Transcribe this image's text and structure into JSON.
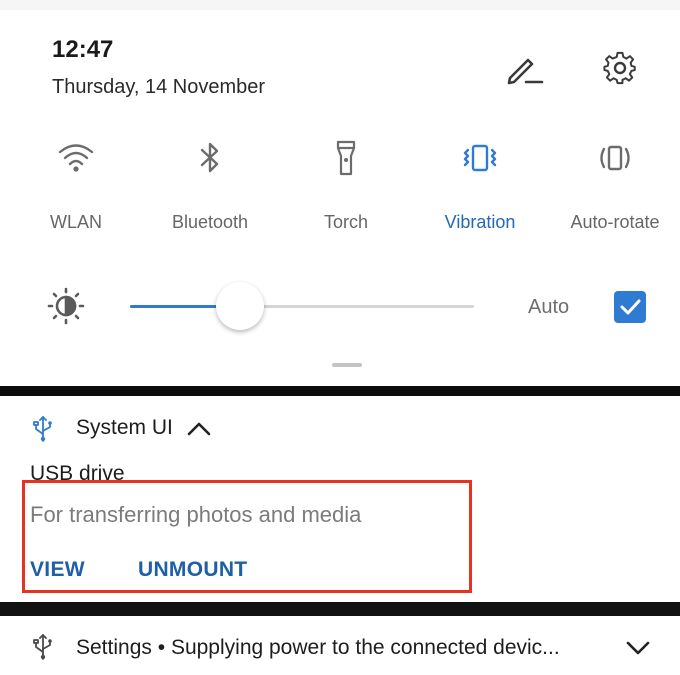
{
  "status": {
    "time": "12:47",
    "date": "Thursday, 14 November"
  },
  "header_icons": {
    "edit": "pencil-icon",
    "settings": "gear-icon"
  },
  "tiles": [
    {
      "label": "WLAN",
      "icon": "wifi-icon",
      "active": false
    },
    {
      "label": "Bluetooth",
      "icon": "bluetooth-icon",
      "active": false
    },
    {
      "label": "Torch",
      "icon": "torch-icon",
      "active": false
    },
    {
      "label": "Vibration",
      "icon": "vibration-icon",
      "active": true
    },
    {
      "label": "Auto-rotate",
      "icon": "auto-rotate-icon",
      "active": false
    }
  ],
  "brightness": {
    "level": 0.32,
    "auto_label": "Auto",
    "auto_checked": true
  },
  "notifications": [
    {
      "app": "System UI",
      "title": "USB drive",
      "body": "For transferring photos and media",
      "actions": [
        "VIEW",
        "UNMOUNT"
      ],
      "icon": "usb-icon"
    },
    {
      "app": "Settings",
      "separator": "•",
      "summary": "Supplying power to the connected devic...",
      "icon": "usb-icon"
    }
  ],
  "colors": {
    "accent": "#2f7bd2",
    "active_label": "#2369b6",
    "action_text": "#1f5fa8",
    "highlight": "#e8311f"
  }
}
